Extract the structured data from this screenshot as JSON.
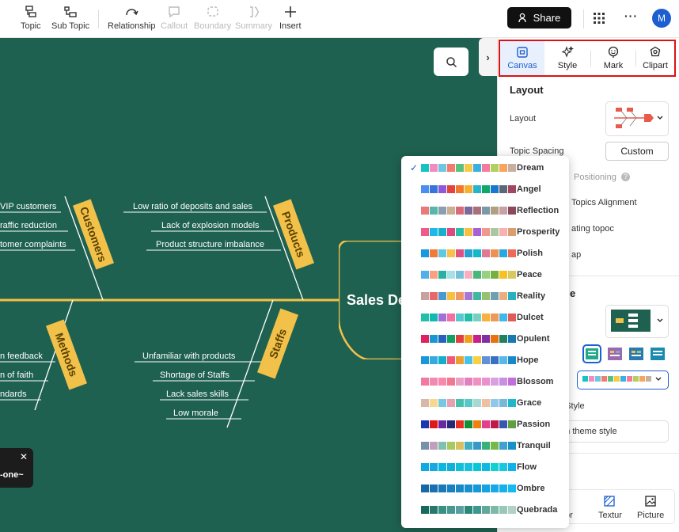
{
  "toolbar": {
    "topic": "Topic",
    "sub_topic": "Sub Topic",
    "relationship": "Relationship",
    "callout": "Callout",
    "boundary": "Boundary",
    "summary": "Summary",
    "insert": "Insert",
    "share": "Share",
    "avatar": "M"
  },
  "diagram": {
    "head": "Sales De",
    "categories": {
      "customers": "Customers",
      "products": "Products",
      "methods": "Methods",
      "staffs": "Staffs"
    },
    "customers_items": [
      "VIP customers",
      "raffic reduction",
      "tomer complaints"
    ],
    "products_items": [
      "Low ratio of deposits and sales",
      "Lack of explosion models",
      "Product structure imbalance"
    ],
    "methods_items": [
      "n feedback",
      "n of faith",
      "ndards"
    ],
    "staffs_items": [
      "Unfamiliar with products",
      "Shortage of Staffs",
      "Lack sales skills",
      "Low morale"
    ],
    "colors": {
      "canvas": "#1f6150",
      "category": "#f2c14a",
      "spine": "#f2c14a"
    }
  },
  "toast": {
    "text": "-one~"
  },
  "panel": {
    "tabs": [
      {
        "label": "Canvas",
        "icon": "canvas-icon",
        "active": true
      },
      {
        "label": "Style",
        "icon": "style-icon",
        "active": false
      },
      {
        "label": "Mark",
        "icon": "mark-icon",
        "active": false
      },
      {
        "label": "Clipart",
        "icon": "clipart-icon",
        "active": false
      }
    ],
    "layout_title": "Layout",
    "layout_label": "Layout",
    "topic_spacing_label": "Topic Spacing",
    "custom_button": "Custom",
    "positioning_label": "Positioning",
    "topics_alignment_label": "Topics Alignment",
    "floating_label": "ating topoc",
    "overlap_label": "ap",
    "theme_title_partial": "e",
    "rainbow_style_label": "n Style",
    "custom_theme_label": "om theme style",
    "background_tabs": [
      {
        "label": "or",
        "icon": "color-icon"
      },
      {
        "label": "Textur",
        "icon": "texture-icon"
      },
      {
        "label": "Picture",
        "icon": "picture-icon"
      }
    ]
  },
  "color_schemes": [
    {
      "name": "Dream",
      "selected": true,
      "colors": [
        "#15c3c2",
        "#f08cc0",
        "#6ec6e0",
        "#f47a6c",
        "#5bc07c",
        "#f7c948",
        "#3ab0e2",
        "#f47aa0",
        "#b0d060",
        "#f7a55c",
        "#c8b0a0"
      ]
    },
    {
      "name": "Angel",
      "selected": false,
      "colors": [
        "#4a8ef0",
        "#3a74d8",
        "#8a5ad8",
        "#e0443c",
        "#f07828",
        "#f8b030",
        "#28b4c8",
        "#10a868",
        "#1878d0",
        "#5c6878",
        "#a04860"
      ]
    },
    {
      "name": "Reflection",
      "selected": false,
      "colors": [
        "#e87a7a",
        "#5ab6a8",
        "#8aa0b0",
        "#c8b090",
        "#d86a7a",
        "#7a6a9a",
        "#a8707a",
        "#7a9aa8",
        "#b0a080",
        "#c8a0a8",
        "#8a4a5a"
      ]
    },
    {
      "name": "Prosperity",
      "selected": false,
      "colors": [
        "#f05a8a",
        "#20b8e8",
        "#1ab0c8",
        "#e04880",
        "#28c0a8",
        "#f8c040",
        "#a860d8",
        "#f09890",
        "#a8c8a0",
        "#f8b0b0",
        "#d8a070"
      ]
    },
    {
      "name": "Polish",
      "selected": false,
      "colors": [
        "#1898e0",
        "#f07a3a",
        "#60c8e0",
        "#f8c048",
        "#e05080",
        "#28a0d0",
        "#10b8c8",
        "#e07898",
        "#f09050",
        "#28a8e0",
        "#f06858"
      ]
    },
    {
      "name": "Peace",
      "selected": false,
      "colors": [
        "#50b0e8",
        "#f8a080",
        "#28b0a0",
        "#a8e0e8",
        "#78c0d8",
        "#f8b0c0",
        "#48b878",
        "#98d080",
        "#78b040",
        "#f8c020",
        "#d8c860"
      ]
    },
    {
      "name": "Reality",
      "selected": false,
      "colors": [
        "#c8a0a0",
        "#e86868",
        "#4a98d0",
        "#f8c040",
        "#f09868",
        "#a878d0",
        "#40b8a0",
        "#98c070",
        "#70a0b0",
        "#e8b080",
        "#28b0c0"
      ]
    },
    {
      "name": "Dulcet",
      "selected": false,
      "colors": [
        "#20c0a8",
        "#10b8b0",
        "#a070d8",
        "#f070a0",
        "#58c8d0",
        "#20c0a8",
        "#78d0c0",
        "#f8b040",
        "#f09858",
        "#40b8e8",
        "#e05a5a"
      ]
    },
    {
      "name": "Opulent",
      "selected": false,
      "colors": [
        "#e02060",
        "#1898d0",
        "#2860c0",
        "#10a060",
        "#e04040",
        "#f0a020",
        "#c8208a",
        "#8030a0",
        "#e87010",
        "#208060",
        "#1878b0"
      ]
    },
    {
      "name": "Hope",
      "selected": false,
      "colors": [
        "#1898d8",
        "#38a8e0",
        "#10b0c8",
        "#f05878",
        "#e8a030",
        "#48c0e8",
        "#f8d040",
        "#6090d8",
        "#3a70c0",
        "#58b8e8",
        "#1a88c8"
      ]
    },
    {
      "name": "Blossom",
      "selected": false,
      "colors": [
        "#f07aa0",
        "#f08ab0",
        "#f888b0",
        "#f07890",
        "#e8a0c8",
        "#e080c0",
        "#f090c0",
        "#e890d0",
        "#d8a0e0",
        "#c890e0",
        "#c070d8"
      ]
    },
    {
      "name": "Grace",
      "selected": false,
      "colors": [
        "#d8b8a8",
        "#f8d890",
        "#78c8e0",
        "#e8a0b0",
        "#48c0b0",
        "#58c8c8",
        "#a8d8d0",
        "#f0c0a0",
        "#90c8e8",
        "#78b8d8",
        "#20b8c8"
      ]
    },
    {
      "name": "Passion",
      "selected": false,
      "colors": [
        "#1838b0",
        "#e01818",
        "#6828a0",
        "#282878",
        "#e83020",
        "#10903a",
        "#f08010",
        "#e04090",
        "#c01848",
        "#3858b0",
        "#60a040"
      ]
    },
    {
      "name": "Tranquil",
      "selected": false,
      "colors": [
        "#7a90a8",
        "#c0a0b8",
        "#80c0b0",
        "#a8c860",
        "#d8c060",
        "#40b0c0",
        "#3898c8",
        "#38b078",
        "#78b848",
        "#40a0d0",
        "#1890c8"
      ]
    },
    {
      "name": "Flow",
      "selected": false,
      "colors": [
        "#10a8e0",
        "#18a8e0",
        "#08b8e0",
        "#10b0d8",
        "#10c0d8",
        "#18c0e0",
        "#08c8d8",
        "#10b8e0",
        "#10d0d0",
        "#18c8e0",
        "#10b0e8"
      ]
    },
    {
      "name": "Ombre",
      "selected": false,
      "colors": [
        "#1868a8",
        "#1870b0",
        "#1878b8",
        "#1880c0",
        "#1888c8",
        "#1890d0",
        "#1898d8",
        "#18a0e0",
        "#18a8e8",
        "#18b0e8",
        "#18b8f0"
      ]
    },
    {
      "name": "Quebrada",
      "selected": false,
      "colors": [
        "#186860",
        "#287870",
        "#389080",
        "#489890",
        "#58a0a0",
        "#2a8878",
        "#3a9890",
        "#60a898",
        "#80b8a8",
        "#98c8b8",
        "#b0d0c8"
      ]
    }
  ]
}
